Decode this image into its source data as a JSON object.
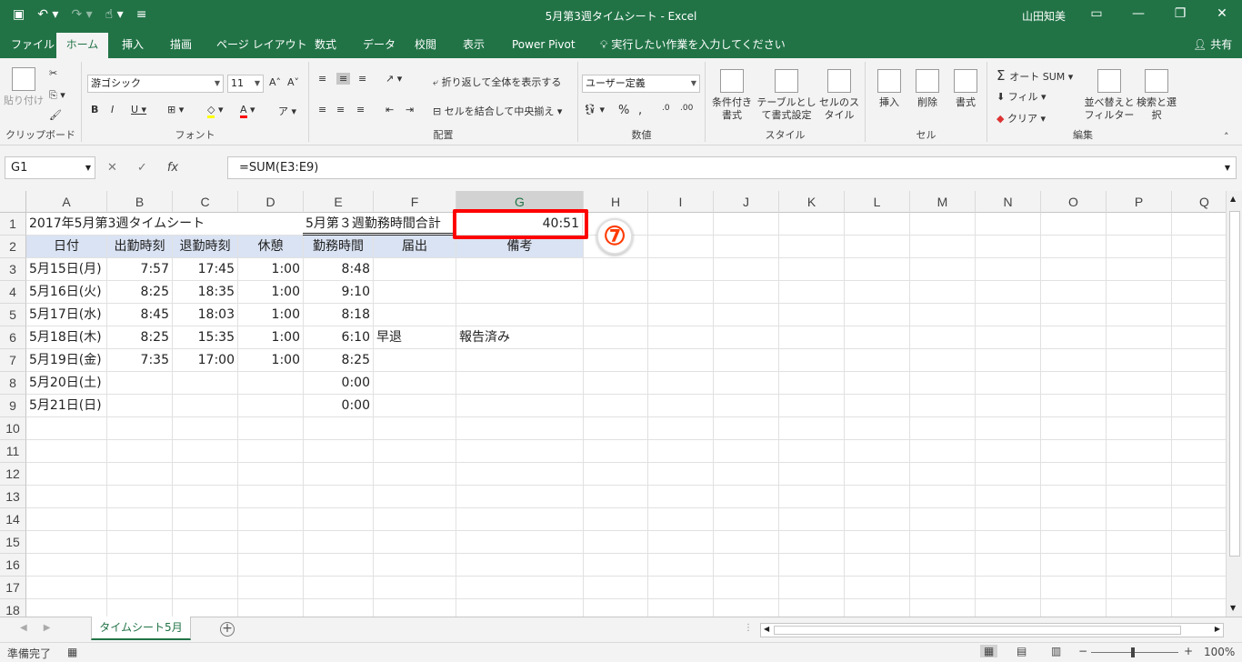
{
  "window": {
    "title": "5月第3週タイムシート  -  Excel",
    "user": "山田知美"
  },
  "tabs": [
    "ファイル",
    "ホーム",
    "挿入",
    "描画",
    "ページ レイアウト",
    "数式",
    "データ",
    "校閲",
    "表示",
    "Power Pivot"
  ],
  "tell_me": "実行したい作業を入力してください",
  "share": "共有",
  "ribbon": {
    "clipboard": {
      "label": "クリップボード",
      "paste": "貼り付け"
    },
    "font": {
      "label": "フォント",
      "name": "游ゴシック",
      "size": "11"
    },
    "alignment": {
      "label": "配置",
      "wrap": "折り返して全体を表示する",
      "merge": "セルを結合して中央揃え"
    },
    "number": {
      "label": "数値",
      "format": "ユーザー定義"
    },
    "styles": {
      "label": "スタイル",
      "conditional": "条件付き書式",
      "table": "テーブルとして書式設定",
      "cell": "セルのスタイル"
    },
    "cells": {
      "label": "セル",
      "insert": "挿入",
      "delete": "削除",
      "format": "書式"
    },
    "editing": {
      "label": "編集",
      "autosum": "オート SUM",
      "fill": "フィル",
      "clear": "クリア",
      "sort": "並べ替えとフィルター",
      "find": "検索と選択"
    }
  },
  "formula_bar": {
    "name_box": "G1",
    "formula": "=SUM(E3:E9)"
  },
  "columns": [
    "A",
    "B",
    "C",
    "D",
    "E",
    "F",
    "G",
    "H",
    "I",
    "J",
    "K",
    "L",
    "M",
    "N",
    "O",
    "P",
    "Q"
  ],
  "rows": [
    "1",
    "2",
    "3",
    "4",
    "5",
    "6",
    "7",
    "8",
    "9",
    "10",
    "11",
    "12",
    "13",
    "14",
    "15",
    "16",
    "17",
    "18"
  ],
  "sheet": {
    "a1": "2017年5月第3週タイムシート",
    "e1": "5月第３週勤務時間合計",
    "g1": "40:51",
    "headers": [
      "日付",
      "出勤時刻",
      "退勤時刻",
      "休憩",
      "勤務時間",
      "届出",
      "備考"
    ],
    "data": [
      [
        "5月15日(月)",
        "7:57",
        "17:45",
        "1:00",
        "8:48",
        "",
        ""
      ],
      [
        "5月16日(火)",
        "8:25",
        "18:35",
        "1:00",
        "9:10",
        "",
        ""
      ],
      [
        "5月17日(水)",
        "8:45",
        "18:03",
        "1:00",
        "8:18",
        "",
        ""
      ],
      [
        "5月18日(木)",
        "8:25",
        "15:35",
        "1:00",
        "6:10",
        "早退",
        "報告済み"
      ],
      [
        "5月19日(金)",
        "7:35",
        "17:00",
        "1:00",
        "8:25",
        "",
        ""
      ],
      [
        "5月20日(土)",
        "",
        "",
        "",
        "0:00",
        "",
        ""
      ],
      [
        "5月21日(日)",
        "",
        "",
        "",
        "0:00",
        "",
        ""
      ]
    ]
  },
  "annotation": "⑦",
  "sheet_tab": "タイムシート5月",
  "status": {
    "ready": "準備完了",
    "zoom": "100%"
  }
}
